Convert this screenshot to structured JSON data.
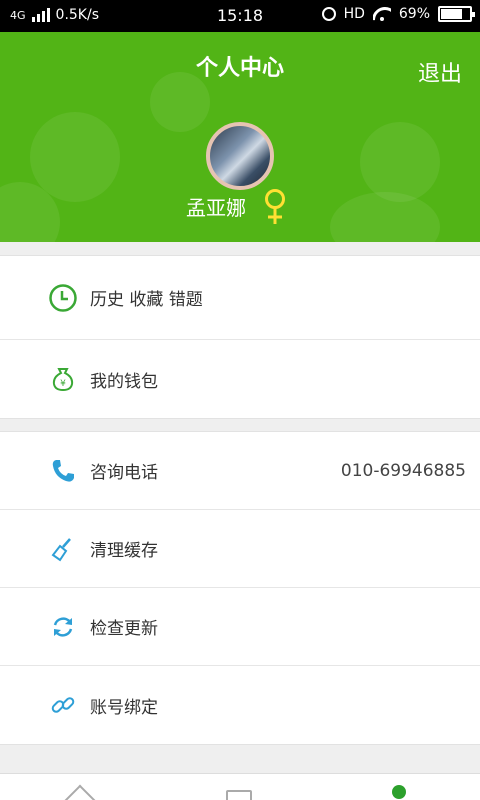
{
  "status_bar": {
    "network": "4G",
    "speed": "0.5K/s",
    "time": "15:18",
    "hd": "HD",
    "battery": "69%"
  },
  "header": {
    "title": "个人中心",
    "logout_label": "退出",
    "username": "孟亚娜",
    "gender_icon": "female-symbol-icon",
    "bg_color": "#52b416"
  },
  "group1": [
    {
      "label": "历史 收藏 错题",
      "icon": "clock-icon"
    },
    {
      "label": "我的钱包",
      "icon": "money-bag-icon"
    }
  ],
  "group2": [
    {
      "label": "咨询电话",
      "value": "010-69946885",
      "icon": "phone-icon"
    },
    {
      "label": "清理缓存",
      "icon": "brush-icon"
    },
    {
      "label": "检查更新",
      "icon": "refresh-icon"
    },
    {
      "label": "账号绑定",
      "icon": "link-icon"
    }
  ]
}
